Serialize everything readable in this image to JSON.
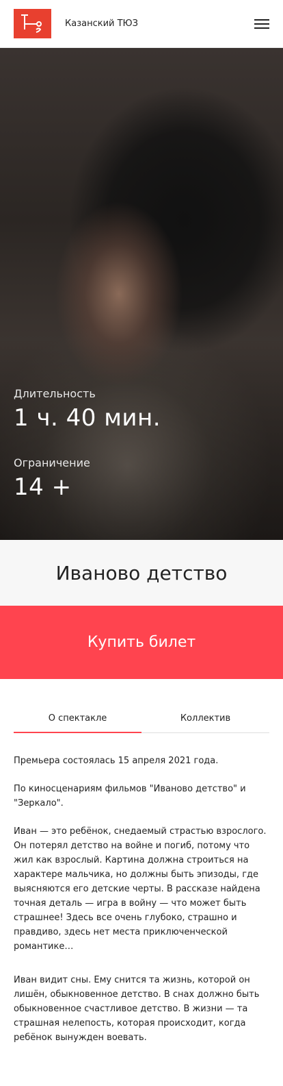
{
  "header": {
    "site_title": "Казанский ТЮЗ",
    "logo_letters": "ТЮЗ"
  },
  "hero": {
    "duration_label": "Длительность",
    "duration_value": "1 ч. 40 мин.",
    "age_label": "Ограничение",
    "age_value": "14 +"
  },
  "show": {
    "title": "Иваново детство",
    "buy_label": "Купить билет"
  },
  "tabs": [
    {
      "label": "О спектакле",
      "active": true
    },
    {
      "label": "Коллектив",
      "active": false
    }
  ],
  "description": [
    "Премьера состоялась 15 апреля 2021 года.",
    "По киносценариям фильмов \"Иваново детство\" и \"Зеркало\".",
    "Иван — это ребёнок, снедаемый страстью взрослого. Он потерял детство на войне и погиб, потому что жил как взрослый. Картина должна строиться на характере мальчика, но должны быть эпизоды, где выясняются его детские черты. В рассказе найдена точная деталь — игра в войну — что может быть страшнее! Здесь все очень глубоко, страшно и правдиво, здесь нет места приключенческой романтике…",
    "Иван видит сны. Ему снится та жизнь, которой он лишён, обыкновенное детство. В снах должно быть обыкновенное счастливое детство. В жизни — та страшная нелепость, которая происходит, когда ребёнок вынужден воевать."
  ],
  "colors": {
    "brand_red": "#e8402f",
    "accent_red": "#ff444f"
  }
}
